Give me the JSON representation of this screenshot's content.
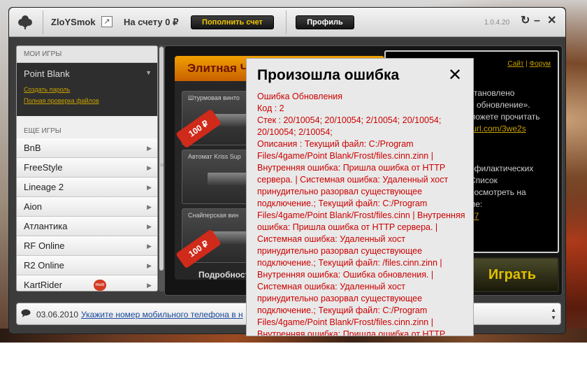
{
  "titlebar": {
    "username": "ZloYSmok",
    "balance": "На счету 0 ₽",
    "topup_label": "Пополнить счет",
    "profile_label": "Профиль",
    "version": "1.0.4.20"
  },
  "sidebar": {
    "my_games_header": "МОИ ИГРЫ",
    "my_game": {
      "title": "Point Blank",
      "links": [
        "Создать пароль",
        "Полная проверка файлов"
      ]
    },
    "other_games_header": "ЕЩЕ ИГРЫ",
    "games": [
      {
        "label": "BnB"
      },
      {
        "label": "FreeStyle"
      },
      {
        "label": "Lineage 2"
      },
      {
        "label": "Aion"
      },
      {
        "label": "Атлантика"
      },
      {
        "label": "RF Online"
      },
      {
        "label": "R2 Online"
      },
      {
        "label": "KartRider",
        "badge": "нью"
      }
    ]
  },
  "banner": {
    "heading": "Элитная Ч",
    "weapons": [
      {
        "label": "Штурмовая винто",
        "price": "100 ₽"
      },
      {
        "label": "Автомат Kriss Sup",
        "price": ""
      },
      {
        "label": "Снайперская вин",
        "price": "100 ₽"
      }
    ],
    "details": "Подробност"
  },
  "news": {
    "site_link": "Сайт",
    "separator": "|",
    "forum_link": "Форум",
    "lines": [
      {
        "text": "становлено",
        "link": false
      },
      {
        "text": "е обновление».",
        "link": false
      },
      {
        "text": "можете прочитать",
        "link": false
      },
      {
        "text": "turl.com/3we2s",
        "link": true
      },
      {
        "text": "офилактических",
        "link": false
      },
      {
        "text": "Список",
        "link": false
      },
      {
        "text": "посмотреть на",
        "link": false
      },
      {
        "text": "ме:",
        "link": false
      },
      {
        "text": "97",
        "link": true
      }
    ]
  },
  "play_label": "Играть",
  "statusbar": {
    "date": "03.06.2010",
    "message": "Укажите номер мобильного телефона в н"
  },
  "dialog": {
    "title": "Произошла ошибка",
    "lines": [
      "Ошибка Обновления",
      "Код : 2",
      "Стек : 20/10054; 20/10054; 2/10054; 20/10054; 20/10054; 2/10054;",
      "Описания : Текущий файл: C:/Program Files/4game/Point Blank/Frost/files.cinn.zinn | Внутренняя ошибка: Пришла ошибка от HTTP сервера. | Системная ошибка: Удаленный хост принудительно разорвал существующее подключение.; Текущий файл: C:/Program Files/4game/Point Blank/Frost/files.cinn | Внутренняя ошибка: Пришла ошибка от HTTP сервера. | Системная ошибка: Удаленный хост принудительно разорвал существующее подключение.; Текущий файл: /files.cinn.zinn | Внутренняя ошибка: Ошибка обновления. | Системная ошибка: Удаленный хост принудительно разорвал существующее подключение.; Текущий файл: C:/Program Files/4game/Point Blank/Frost/files.cinn.zinn | Внутренняя ошибка: Пришла ошибка от HTTP"
    ]
  }
}
